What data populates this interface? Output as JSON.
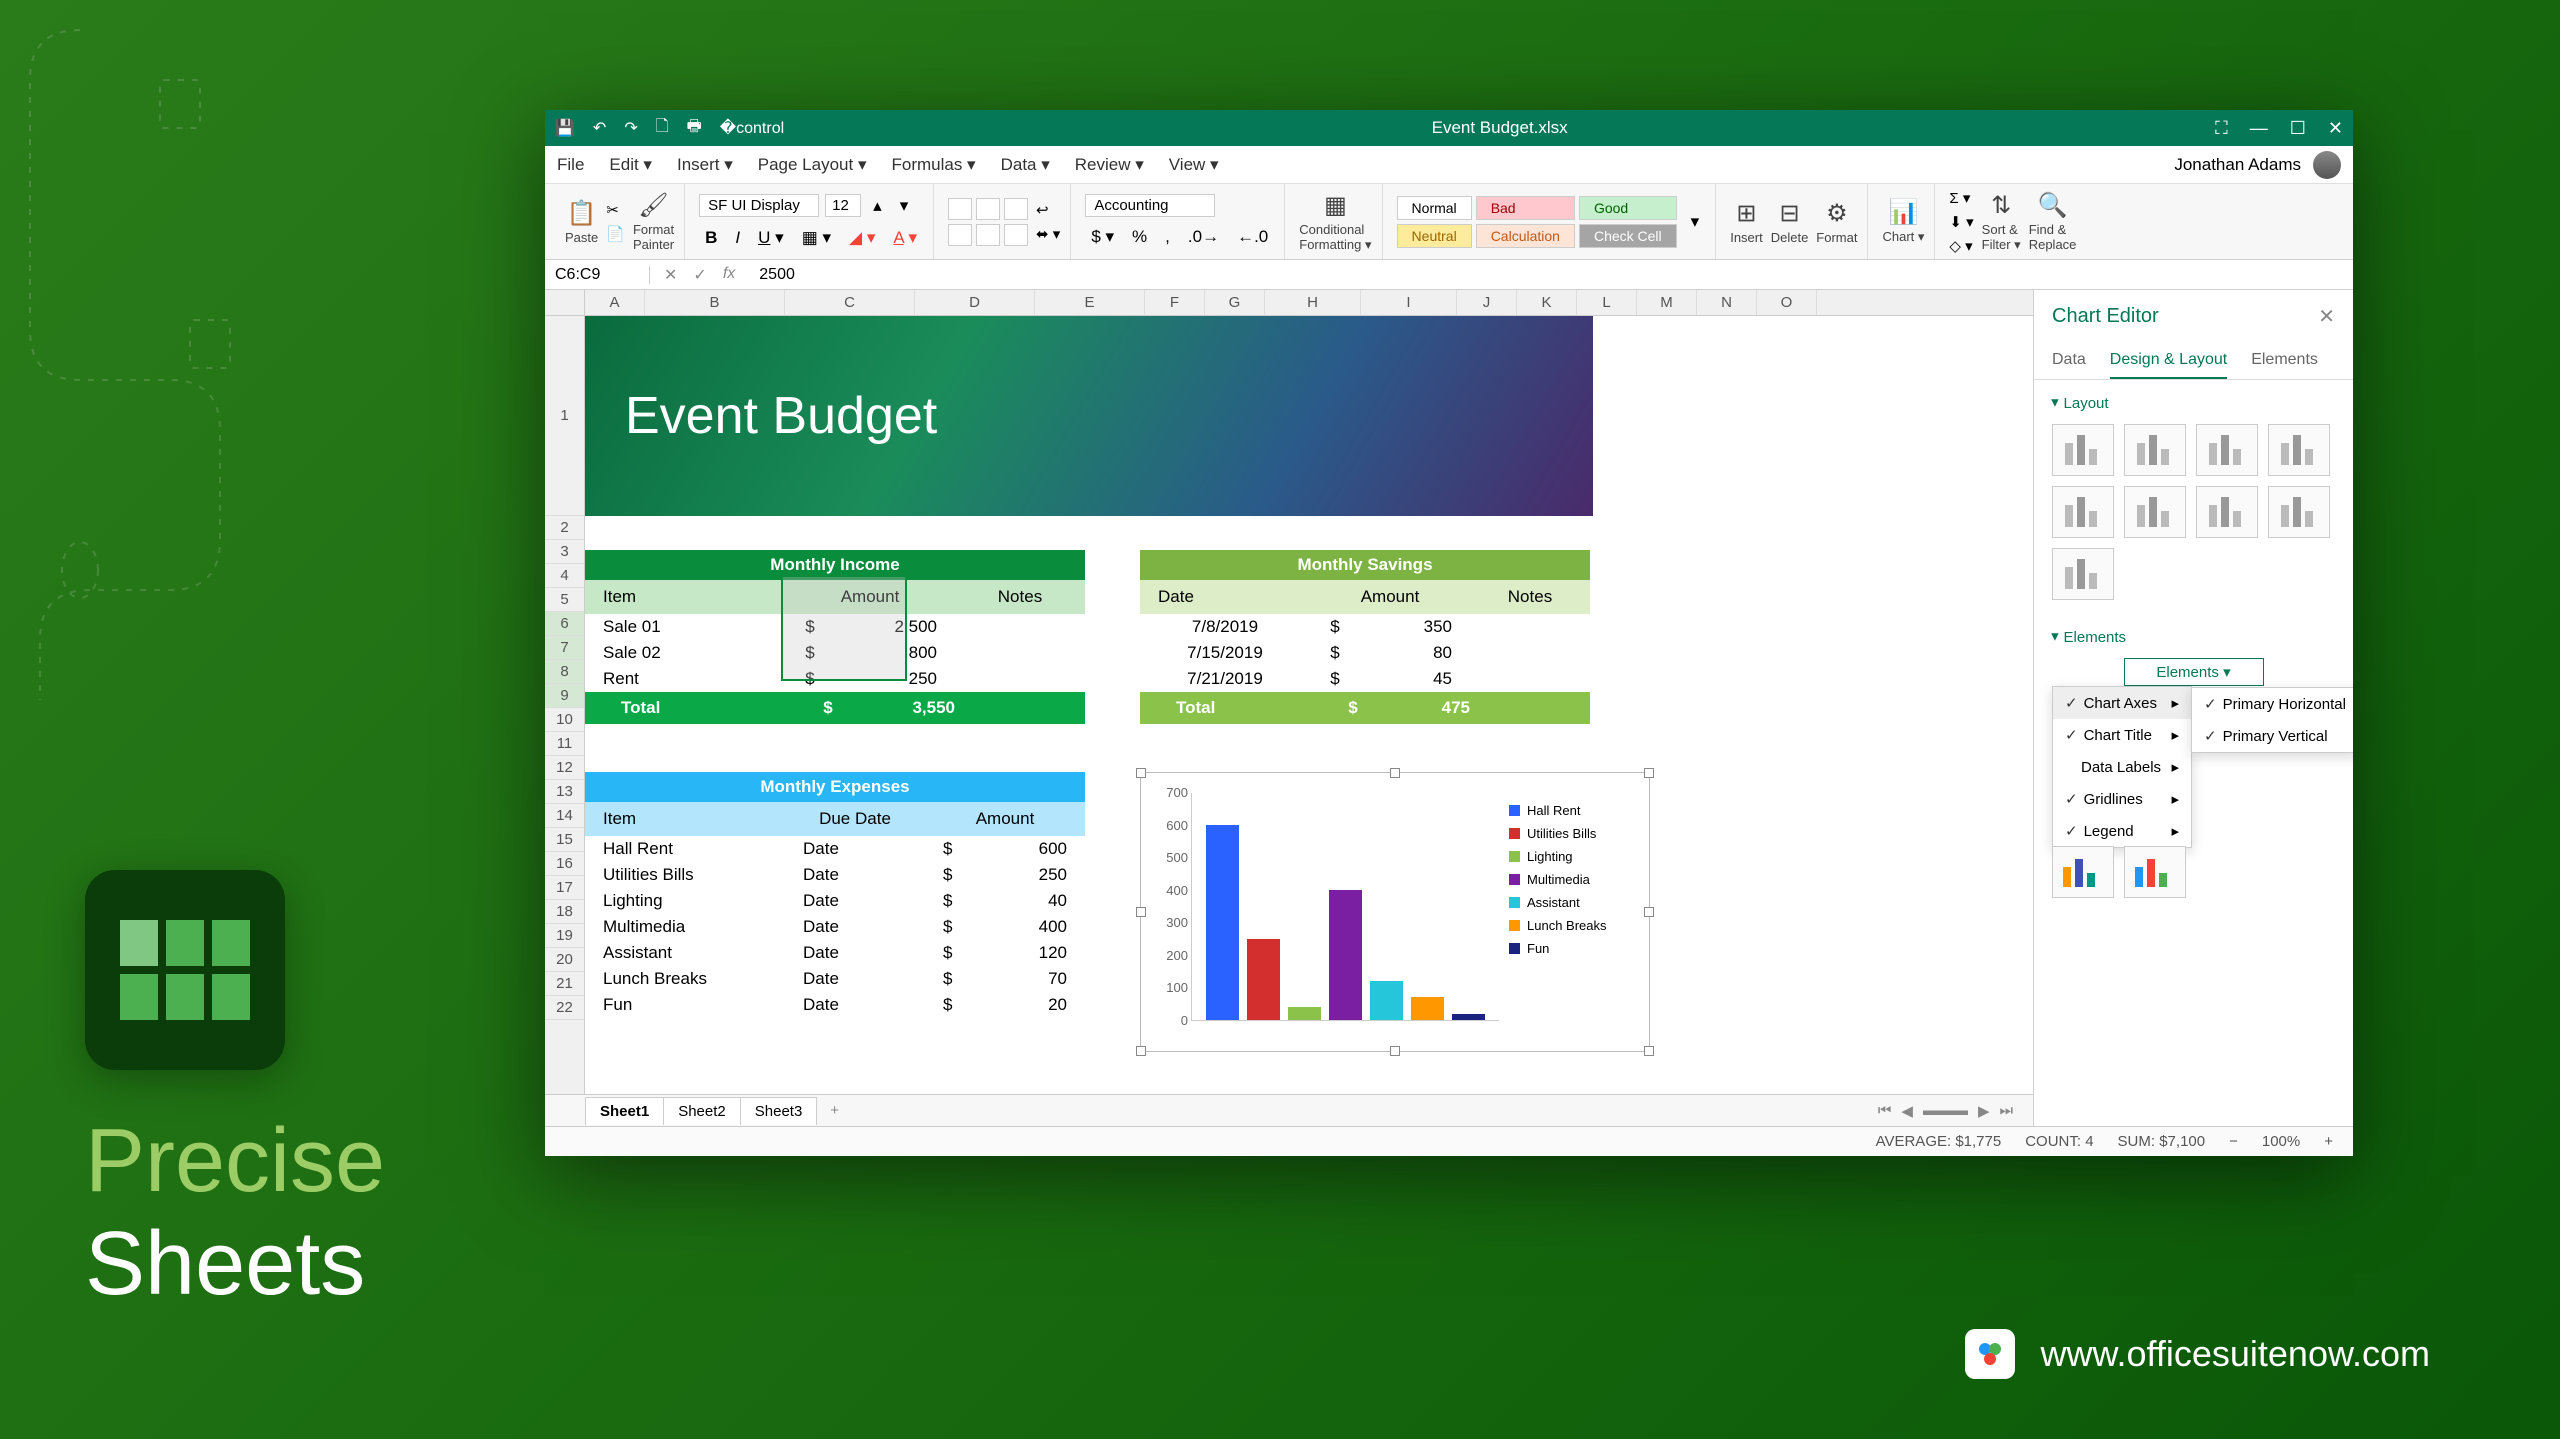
{
  "promo": {
    "line1": "Precise",
    "line2": "Sheets",
    "url": "www.officesuitenow.com"
  },
  "window": {
    "title": "Event Budget.xlsx"
  },
  "menu": {
    "items": [
      "File",
      "Edit ▾",
      "Insert ▾",
      "Page Layout ▾",
      "Formulas ▾",
      "Data ▾",
      "Review ▾",
      "View ▾"
    ],
    "user": "Jonathan Adams"
  },
  "ribbon": {
    "paste": "Paste",
    "format_painter": "Format\nPainter",
    "font": "SF UI Display",
    "font_size": "12",
    "num_format": "Accounting",
    "cond_format": "Conditional\nFormatting ▾",
    "styles": {
      "normal": "Normal",
      "bad": "Bad",
      "good": "Good",
      "neutral": "Neutral",
      "calc": "Calculation",
      "check": "Check Cell"
    },
    "insert": "Insert",
    "delete": "Delete",
    "format": "Format",
    "chart": "Chart ▾",
    "sort": "Sort &\nFilter ▾",
    "find": "Find &\nReplace"
  },
  "formula": {
    "ref": "C6:C9",
    "val": "2500"
  },
  "columns": [
    "A",
    "B",
    "C",
    "D",
    "E",
    "F",
    "G",
    "H",
    "I",
    "J",
    "K",
    "L",
    "M",
    "N",
    "O"
  ],
  "banner_title": "Event Budget",
  "income": {
    "title": "Monthly Income",
    "cols": [
      "Item",
      "Amount",
      "Notes"
    ],
    "rows": [
      [
        "Sale 01",
        "$",
        "2,500"
      ],
      [
        "Sale 02",
        "$",
        "800"
      ],
      [
        "Rent",
        "$",
        "250"
      ]
    ],
    "total": [
      "Total",
      "$",
      "3,550"
    ]
  },
  "savings": {
    "title": "Monthly Savings",
    "cols": [
      "Date",
      "Amount",
      "Notes"
    ],
    "rows": [
      [
        "7/8/2019",
        "$",
        "350"
      ],
      [
        "7/15/2019",
        "$",
        "80"
      ],
      [
        "7/21/2019",
        "$",
        "45"
      ]
    ],
    "total": [
      "Total",
      "$",
      "475"
    ]
  },
  "expenses": {
    "title": "Monthly Expenses",
    "cols": [
      "Item",
      "Due Date",
      "Amount"
    ],
    "rows": [
      [
        "Hall Rent",
        "Date",
        "$",
        "600"
      ],
      [
        "Utilities Bills",
        "Date",
        "$",
        "250"
      ],
      [
        "Lighting",
        "Date",
        "$",
        "40"
      ],
      [
        "Multimedia",
        "Date",
        "$",
        "400"
      ],
      [
        "Assistant",
        "Date",
        "$",
        "120"
      ],
      [
        "Lunch Breaks",
        "Date",
        "$",
        "70"
      ],
      [
        "Fun",
        "Date",
        "$",
        "20"
      ]
    ]
  },
  "chart_data": {
    "type": "bar",
    "categories": [
      "Hall Rent",
      "Utilities Bills",
      "Lighting",
      "Multimedia",
      "Assistant",
      "Lunch Breaks",
      "Fun"
    ],
    "values": [
      600,
      250,
      40,
      400,
      120,
      70,
      20
    ],
    "colors": [
      "#2962ff",
      "#d32f2f",
      "#8bc34a",
      "#7b1fa2",
      "#26c6da",
      "#ff9800",
      "#1a237e"
    ],
    "ylim": [
      0,
      700
    ],
    "yticks": [
      0,
      100,
      200,
      300,
      400,
      500,
      600,
      700
    ],
    "title": "",
    "xlabel": "",
    "ylabel": ""
  },
  "chart_editor": {
    "title": "Chart Editor",
    "tabs": [
      "Data",
      "Design & Layout",
      "Elements"
    ],
    "active_tab": 1,
    "layout": "Layout",
    "elements": "Elements",
    "elements_btn": "Elements ▾",
    "menu": [
      {
        "label": "Chart Axes",
        "check": true,
        "sub": true
      },
      {
        "label": "Chart Title",
        "check": true,
        "sub": true
      },
      {
        "label": "Data Labels",
        "check": false,
        "sub": true
      },
      {
        "label": "Gridlines",
        "check": true,
        "sub": true
      },
      {
        "label": "Legend",
        "check": true,
        "sub": true
      }
    ],
    "submenu": [
      {
        "label": "Primary Horizontal",
        "check": true
      },
      {
        "label": "Primary Vertical",
        "check": true
      }
    ]
  },
  "sheets": [
    "Sheet1",
    "Sheet2",
    "Sheet3"
  ],
  "status": {
    "avg": "AVERAGE: $1,775",
    "count": "COUNT: 4",
    "sum": "SUM: $7,100",
    "zoom": "100%"
  }
}
